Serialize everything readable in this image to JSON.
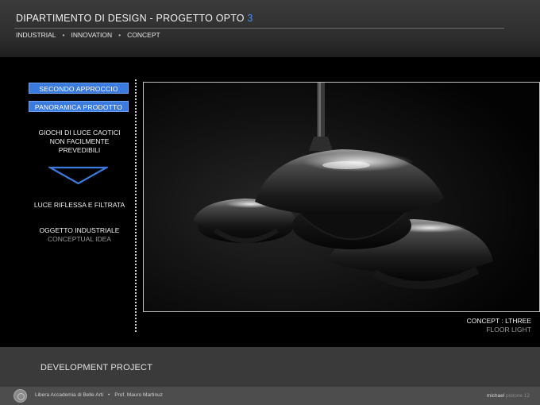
{
  "header": {
    "title_main": "DIPARTIMENTO DI DESIGN  -  PROGETTO OPTO ",
    "title_accent": "3",
    "nav": [
      "INDUSTRIAL",
      "INNOVATION",
      "CONCEPT"
    ],
    "nav_separator": "•"
  },
  "sidebar": {
    "buttons": [
      "SECONDO APPROCCIO",
      "PANORAMICA PRODOTTO"
    ],
    "text_block_1": [
      "GIOCHI DI LUCE CAOTICI",
      "NON FACILMENTE",
      "PREVEDIBILI"
    ],
    "text_block_2": "LUCE RIFLESSA E FILTRATA",
    "text_block_3_title": "OGGETTO INDUSTRIALE",
    "text_block_3_sub": "CONCEPTUAL IDEA",
    "accent_color": "#3b7be0"
  },
  "caption": {
    "line1": "CONCEPT :   LTHREE",
    "line2": "FLOOR LIGHT"
  },
  "band": {
    "title": "DEVELOPMENT PROJECT"
  },
  "footer": {
    "left_1": "Libera Accademia di Belle Arti",
    "separator": "•",
    "left_2": "Prof. Mauro Martinuz",
    "right_1": "michael ",
    "right_2": "pistone 12"
  }
}
